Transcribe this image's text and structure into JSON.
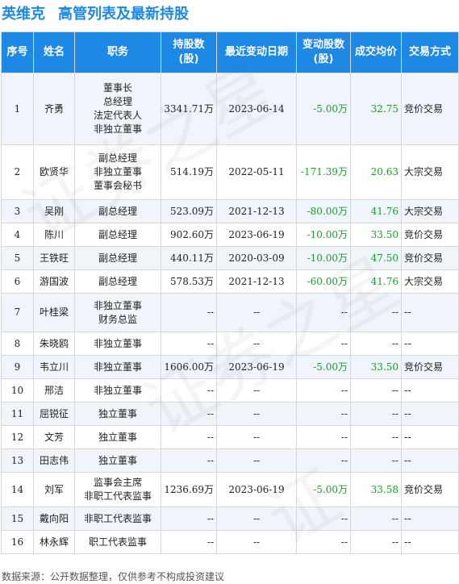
{
  "header": {
    "company": "英维克",
    "title": "高管列表及最新持股"
  },
  "columns": [
    "序号",
    "姓名",
    "职务",
    "持股数\n(股)",
    "最近变动日期",
    "变动股数\n(股)",
    "成交均价",
    "交易方式"
  ],
  "rows": [
    {
      "no": "1",
      "name": "齐勇",
      "positions": [
        "董事长",
        "总经理",
        "法定代表人",
        "非独立董事"
      ],
      "shares": "3341.71万",
      "date": "2023-06-14",
      "change": "-5.00万",
      "price": "32.75",
      "method": "竞价交易"
    },
    {
      "no": "2",
      "name": "欧贤华",
      "positions": [
        "副总经理",
        "非独立董事",
        "董事会秘书"
      ],
      "shares": "514.19万",
      "date": "2022-05-11",
      "change": "-171.39万",
      "price": "20.63",
      "method": "大宗交易"
    },
    {
      "no": "3",
      "name": "吴刚",
      "positions": [
        "副总经理"
      ],
      "shares": "523.09万",
      "date": "2021-12-13",
      "change": "-80.00万",
      "price": "41.76",
      "method": "大宗交易"
    },
    {
      "no": "4",
      "name": "陈川",
      "positions": [
        "副总经理"
      ],
      "shares": "902.60万",
      "date": "2023-06-19",
      "change": "-10.00万",
      "price": "33.50",
      "method": "竞价交易"
    },
    {
      "no": "5",
      "name": "王铁旺",
      "positions": [
        "副总经理"
      ],
      "shares": "440.11万",
      "date": "2020-03-09",
      "change": "-10.00万",
      "price": "47.50",
      "method": "竞价交易"
    },
    {
      "no": "6",
      "name": "游国波",
      "positions": [
        "副总经理"
      ],
      "shares": "578.53万",
      "date": "2021-12-13",
      "change": "-60.00万",
      "price": "41.76",
      "method": "大宗交易"
    },
    {
      "no": "7",
      "name": "叶桂梁",
      "positions": [
        "非独立董事",
        "财务总监"
      ],
      "shares": "--",
      "date": "--",
      "change": "--",
      "price": "--",
      "method": "--"
    },
    {
      "no": "8",
      "name": "朱晓鸥",
      "positions": [
        "非独立董事"
      ],
      "shares": "--",
      "date": "--",
      "change": "--",
      "price": "--",
      "method": "--"
    },
    {
      "no": "9",
      "name": "韦立川",
      "positions": [
        "非独立董事"
      ],
      "shares": "1606.00万",
      "date": "2023-06-19",
      "change": "-5.00万",
      "price": "33.50",
      "method": "竞价交易"
    },
    {
      "no": "10",
      "name": "邢洁",
      "positions": [
        "非独立董事"
      ],
      "shares": "--",
      "date": "--",
      "change": "--",
      "price": "--",
      "method": "--"
    },
    {
      "no": "11",
      "name": "屈锐征",
      "positions": [
        "独立董事"
      ],
      "shares": "--",
      "date": "--",
      "change": "--",
      "price": "--",
      "method": "--"
    },
    {
      "no": "12",
      "name": "文芳",
      "positions": [
        "独立董事"
      ],
      "shares": "--",
      "date": "--",
      "change": "--",
      "price": "--",
      "method": "--"
    },
    {
      "no": "13",
      "name": "田志伟",
      "positions": [
        "独立董事"
      ],
      "shares": "--",
      "date": "--",
      "change": "--",
      "price": "--",
      "method": "--"
    },
    {
      "no": "14",
      "name": "刘军",
      "positions": [
        "监事会主席",
        "非职工代表监事"
      ],
      "shares": "1236.69万",
      "date": "2023-06-19",
      "change": "-5.00万",
      "price": "33.58",
      "method": "竞价交易"
    },
    {
      "no": "15",
      "name": "戴向阳",
      "positions": [
        "非职工代表监事"
      ],
      "shares": "--",
      "date": "--",
      "change": "--",
      "price": "--",
      "method": "--"
    },
    {
      "no": "16",
      "name": "林永辉",
      "positions": [
        "职工代表监事"
      ],
      "shares": "--",
      "date": "--",
      "change": "--",
      "price": "--",
      "method": "--"
    }
  ],
  "footer": "数据来源：公开数据整理，仅供参考不构成投资建议",
  "colors": {
    "header_bg": "#1e88e5",
    "stripe": "#eff5fb",
    "green": "#1a9e2a"
  }
}
